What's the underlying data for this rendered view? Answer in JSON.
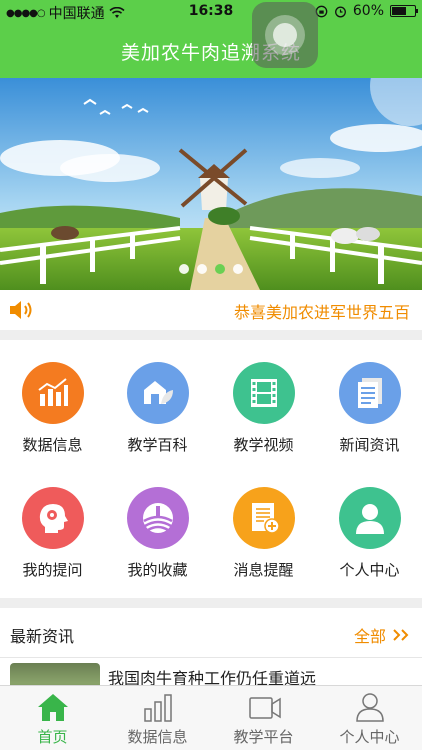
{
  "status_bar": {
    "carrier": "中国联通",
    "time": "16:38",
    "battery": "60%"
  },
  "header": {
    "title": "美加农牛肉追溯系统"
  },
  "banner": {
    "pages": 4,
    "active_page": 3
  },
  "notice": {
    "text": "恭喜美加农进军世界五百",
    "icon": "speaker-icon",
    "color": "#f08c00"
  },
  "grid": {
    "items": [
      {
        "label": "数据信息",
        "icon": "bar-chart-icon",
        "color": "#f47b20"
      },
      {
        "label": "教学百科",
        "icon": "farm-house-icon",
        "color": "#6aa0e8"
      },
      {
        "label": "教学视频",
        "icon": "film-icon",
        "color": "#3ec28f"
      },
      {
        "label": "新闻资讯",
        "icon": "document-icon",
        "color": "#6aa0e8"
      },
      {
        "label": "我的提问",
        "icon": "head-gear-icon",
        "color": "#ef5b5b"
      },
      {
        "label": "我的收藏",
        "icon": "field-icon",
        "color": "#b46fd6"
      },
      {
        "label": "消息提醒",
        "icon": "note-plus-icon",
        "color": "#f7a21b"
      },
      {
        "label": "个人中心",
        "icon": "user-icon",
        "color": "#3ec28f"
      }
    ]
  },
  "news": {
    "heading": "最新资讯",
    "all_label": "全部",
    "items": [
      {
        "title": "我国肉牛育种工作仍任重道远"
      }
    ]
  },
  "tabbar": {
    "items": [
      {
        "label": "首页",
        "icon": "home-icon",
        "active": true
      },
      {
        "label": "数据信息",
        "icon": "bar-chart-icon",
        "active": false
      },
      {
        "label": "教学平台",
        "icon": "video-camera-icon",
        "active": false
      },
      {
        "label": "个人中心",
        "icon": "person-icon",
        "active": false
      }
    ]
  },
  "colors": {
    "brand": "#5ccf4a",
    "accent": "#f08c00",
    "active_tab": "#39b54a"
  }
}
